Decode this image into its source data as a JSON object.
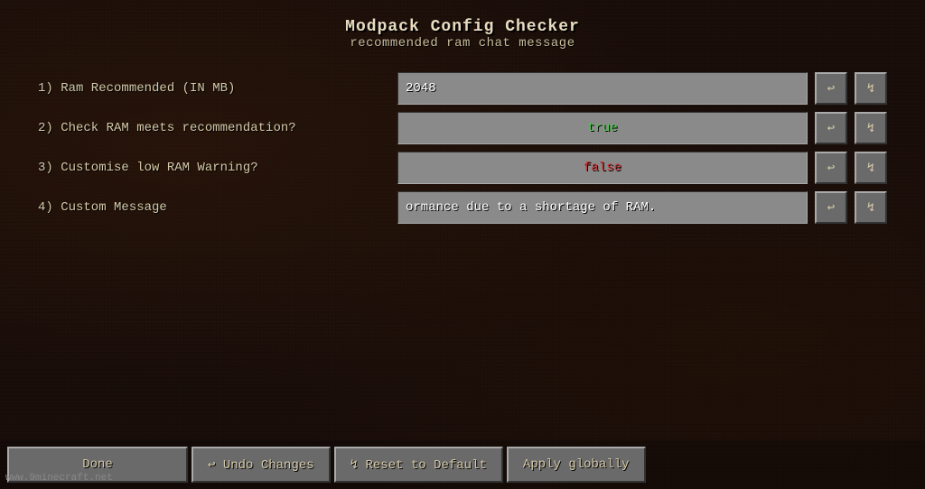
{
  "title": {
    "main": "Modpack Config Checker",
    "sub": "recommended ram chat message"
  },
  "rows": [
    {
      "id": "ram-recommended",
      "label": "1) Ram Recommended (IN MB)",
      "value": "2048",
      "type": "number",
      "undo_label": "↩",
      "reset_label": "↯"
    },
    {
      "id": "check-ram",
      "label": "2) Check RAM meets recommendation?",
      "value": "true",
      "type": "boolean-true",
      "undo_label": "↩",
      "reset_label": "↯"
    },
    {
      "id": "customise-warning",
      "label": "3) Customise low RAM Warning?",
      "value": "false",
      "type": "boolean-false",
      "undo_label": "↩",
      "reset_label": "↯"
    },
    {
      "id": "custom-message",
      "label": "4) Custom Message",
      "value": "ormance due to a shortage of RAM.",
      "type": "text",
      "undo_label": "↩",
      "reset_label": "↯"
    }
  ],
  "buttons": {
    "done": "Done",
    "undo_changes": "↩ Undo Changes",
    "reset_to_default": "↯ Reset to Default",
    "apply_globally": "Apply globally"
  },
  "watermark": "www.9minecraft.net"
}
